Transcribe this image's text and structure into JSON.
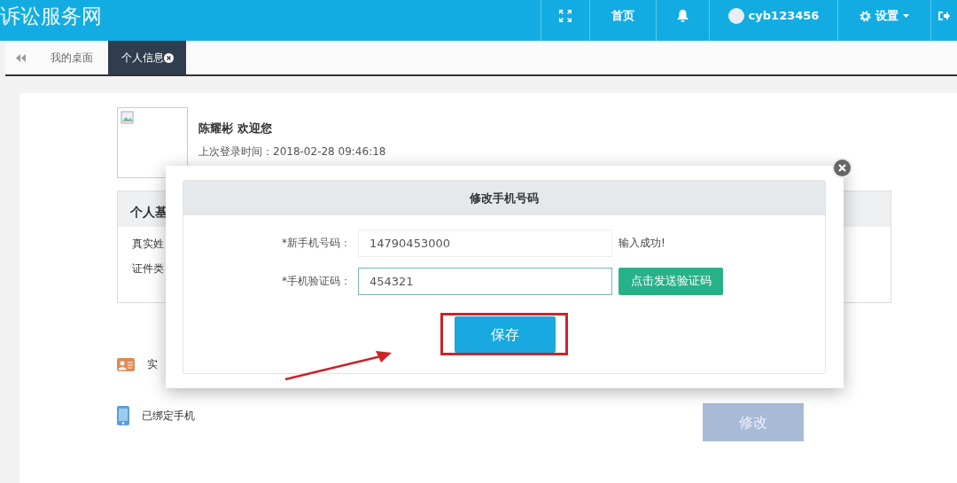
{
  "header": {
    "logo": "诉讼服务网",
    "nav": [
      {
        "kind": "fullscreen"
      },
      {
        "kind": "link",
        "label": "首页"
      },
      {
        "kind": "bell"
      },
      {
        "kind": "user",
        "label": "cyb123456"
      },
      {
        "kind": "settings",
        "label": "设置"
      },
      {
        "kind": "logout"
      }
    ]
  },
  "tabs": [
    {
      "label": "我的桌面",
      "selected": false,
      "closable": false
    },
    {
      "label": "个人信息",
      "selected": true,
      "closable": true
    }
  ],
  "profile": {
    "greeting": "陈耀彬 欢迎您",
    "last_login": "上次登录时间：2018-02-28 09:46:18"
  },
  "info_card": {
    "title": "个人基",
    "rows": [
      "真实姓",
      "证件类"
    ]
  },
  "bindings": [
    {
      "kind": "id-card",
      "label": "实"
    },
    {
      "kind": "phone",
      "label": "已绑定手机",
      "button": "修改"
    }
  ],
  "modal": {
    "title": "修改手机号码",
    "fields": [
      {
        "label": "*新手机号码：",
        "value": "14790453000",
        "focused": false,
        "message": "输入成功!"
      },
      {
        "label": "*手机验证码：",
        "value": "454321",
        "focused": true,
        "button": "点击发送验证码"
      }
    ],
    "save": "保存"
  }
}
